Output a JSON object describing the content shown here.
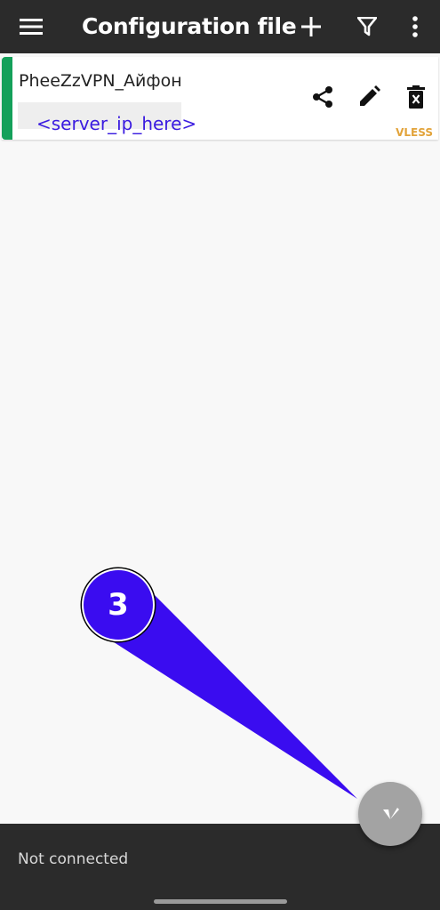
{
  "appbar": {
    "title": "Configuration file",
    "icons": [
      "menu-icon",
      "add-icon",
      "filter-icon",
      "more-vert-icon"
    ]
  },
  "servers": [
    {
      "name": "PheeZzVPN_Айфон",
      "address": "<server_ip_here>",
      "protocol": "VLESS",
      "status_color": "#14a05a",
      "actions": [
        "share-icon",
        "edit-icon",
        "delete-icon"
      ]
    }
  ],
  "annotation": {
    "step": "3",
    "color": "#3a0cf0"
  },
  "status_bar": {
    "text": "Not connected"
  },
  "fab": {
    "icon": "vpn-connect-icon"
  },
  "colors": {
    "toolbar": "#2b2b2b",
    "accent_address": "#3a1be0",
    "protocol": "#e2a33a",
    "fab": "#a3a3a3"
  }
}
